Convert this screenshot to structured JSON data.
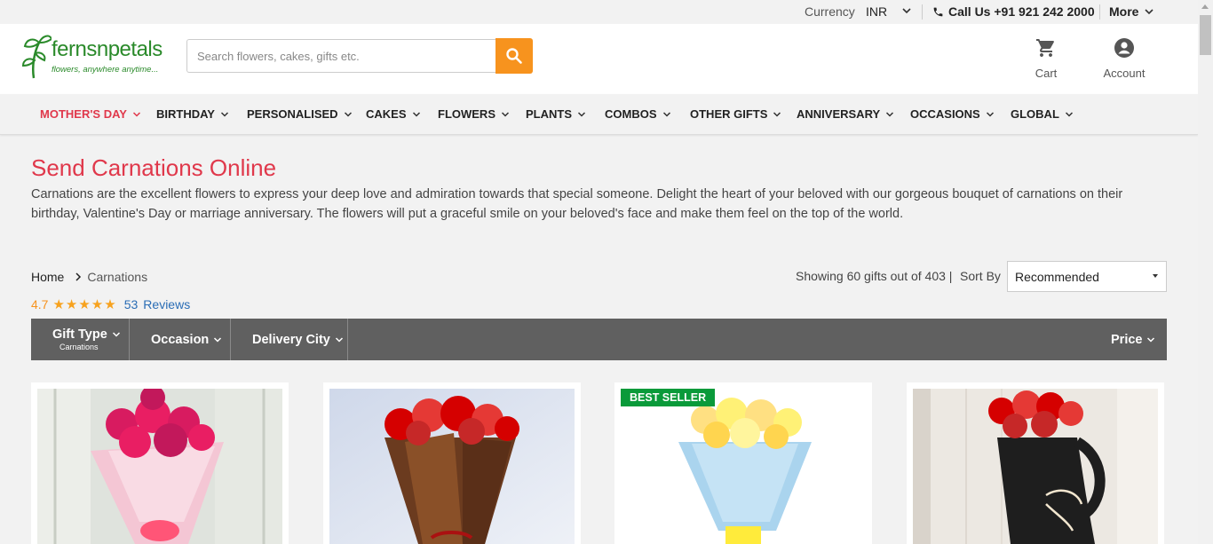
{
  "topbar": {
    "currency_label": "Currency",
    "currency_value": "INR",
    "call_us": "Call Us +91 921 242 2000",
    "more": "More"
  },
  "header": {
    "logo_brand": "fernsnpetals",
    "logo_tagline": "flowers, anywhere anytime...",
    "search_placeholder": "Search flowers, cakes, gifts etc.",
    "cart_label": "Cart",
    "account_label": "Account"
  },
  "nav": {
    "items": [
      {
        "label": "MOTHER'S DAY"
      },
      {
        "label": "BIRTHDAY"
      },
      {
        "label": "PERSONALISED"
      },
      {
        "label": "CAKES"
      },
      {
        "label": "FLOWERS"
      },
      {
        "label": "PLANTS"
      },
      {
        "label": "COMBOS"
      },
      {
        "label": "OTHER GIFTS"
      },
      {
        "label": "ANNIVERSARY"
      },
      {
        "label": "OCCASIONS"
      },
      {
        "label": "GLOBAL"
      }
    ]
  },
  "page": {
    "title": "Send Carnations Online",
    "description": "Carnations are the excellent flowers to express your deep love and admiration towards that special someone. Delight the heart of your beloved with our gorgeous bouquet of carnations on their birthday, Valentine's Day or marriage anniversary. The flowers will put a graceful smile on your beloved's face and make them feel on the top of the world."
  },
  "breadcrumb": {
    "home": "Home",
    "current": "Carnations"
  },
  "rating": {
    "value": "4.7",
    "stars": "★★★★★",
    "count": "53",
    "reviews_label": "Reviews"
  },
  "listing": {
    "showing_text": "Showing 60 gifts out of 403 |",
    "sort_label": "Sort By",
    "sort_value": "Recommended"
  },
  "filters": {
    "gift_type": "Gift Type",
    "gift_type_sub": "Carnations",
    "occasion": "Occasion",
    "delivery_city": "Delivery City",
    "price": "Price"
  },
  "products": [
    {
      "badge": ""
    },
    {
      "badge": ""
    },
    {
      "badge": "BEST SELLER"
    },
    {
      "badge": ""
    }
  ],
  "colors": {
    "brand_green": "#2a8a2a",
    "accent_red": "#e0384b",
    "search_orange": "#f7931e",
    "filter_bar": "#606060",
    "badge_green": "#0a9a3a",
    "link_blue": "#2a6db5"
  }
}
